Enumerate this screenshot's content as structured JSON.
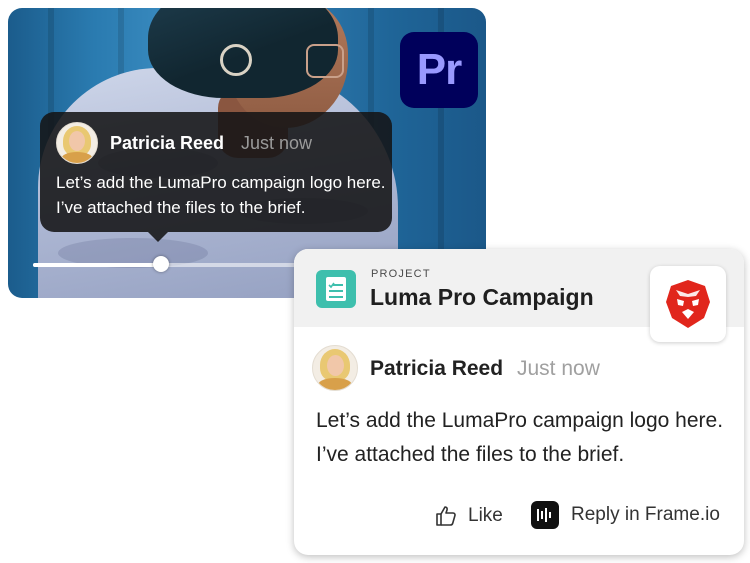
{
  "video": {
    "app_badge": "Pr",
    "comment": {
      "author": "Patricia Reed",
      "time": "Just now",
      "message": "Let’s add the LumaPro campaign logo here. I’ve attached the files to the brief."
    },
    "playhead_progress": 0.29
  },
  "project": {
    "kicker": "PROJECT",
    "title": "Luma Pro Campaign",
    "comment": {
      "author": "Patricia Reed",
      "time": "Just now",
      "message": "Let’s add the LumaPro campaign logo here. I’ve attached the files to the brief."
    },
    "actions": {
      "like_label": "Like",
      "reply_label": "Reply in Frame.io"
    }
  },
  "colors": {
    "premiere_bg": "#00005b",
    "premiere_fg": "#9999ff",
    "project_icon": "#3ebfad",
    "brand_red": "#e1261c"
  }
}
